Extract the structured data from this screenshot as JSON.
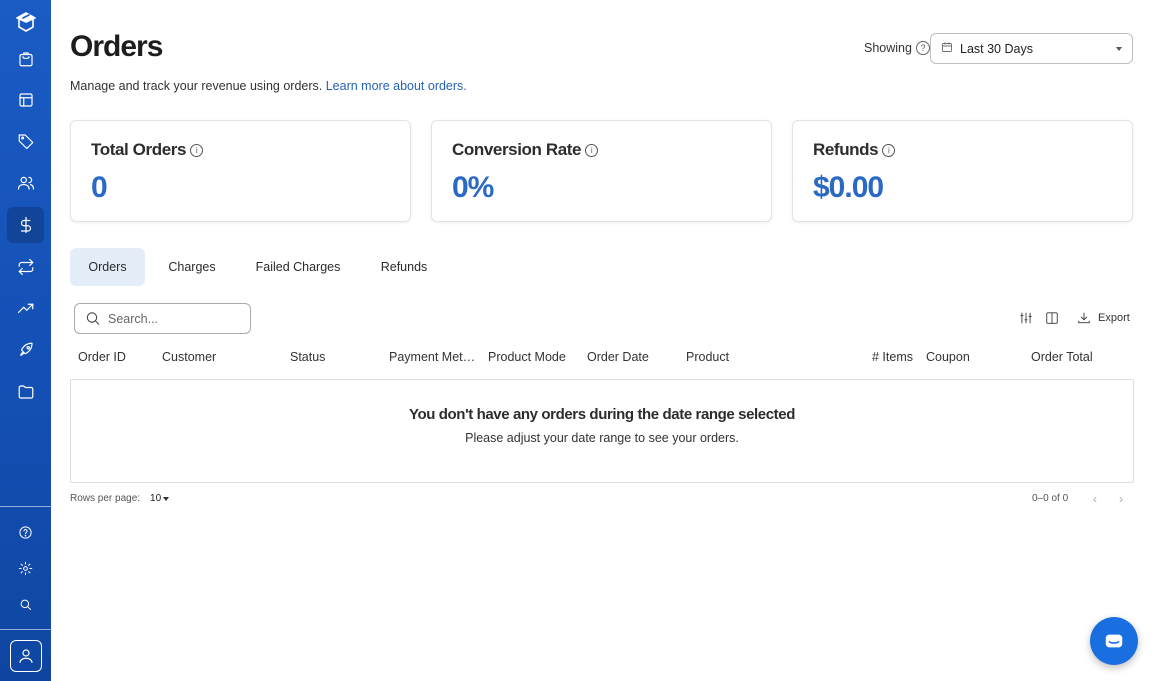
{
  "header": {
    "title": "Orders",
    "subtitle": "Manage and track your revenue using orders.",
    "learn_more": "Learn more about orders.",
    "showing_label": "Showing",
    "date_range": "Last 30 Days"
  },
  "stats": [
    {
      "label": "Total Orders",
      "value": "0"
    },
    {
      "label": "Conversion Rate",
      "value": "0%"
    },
    {
      "label": "Refunds",
      "value": "$0.00"
    }
  ],
  "tabs": [
    {
      "label": "Orders",
      "active": true
    },
    {
      "label": "Charges",
      "active": false
    },
    {
      "label": "Failed Charges",
      "active": false
    },
    {
      "label": "Refunds",
      "active": false
    }
  ],
  "search": {
    "placeholder": "Search..."
  },
  "toolbar": {
    "export_label": "Export"
  },
  "table": {
    "columns": [
      "Order ID",
      "Customer",
      "Status",
      "Payment Met…",
      "Product Mode",
      "Order Date",
      "Product",
      "# Items",
      "Coupon",
      "Order Total"
    ],
    "empty_title": "You don't have any orders during the date range selected",
    "empty_subtitle": "Please adjust your date range to see your orders."
  },
  "pagination": {
    "rows_per_page_label": "Rows per page:",
    "rows_per_page": "10",
    "range": "0–0 of 0"
  },
  "sidebar": {
    "items": [
      "box-icon",
      "shopping-bag-icon",
      "layout-icon",
      "tag-icon",
      "users-icon",
      "dollar-icon",
      "repeat-icon",
      "trending-up-icon",
      "rocket-icon",
      "folder-icon"
    ],
    "active": "dollar-icon",
    "bottom_items": [
      "help-icon",
      "settings-icon",
      "search-icon"
    ]
  },
  "colors": {
    "sidebar": "#1a5bc4",
    "accent": "#2a6ac4",
    "link": "#2563b8",
    "active_tab": "#e4eef9",
    "fab": "#1a6fe0"
  }
}
